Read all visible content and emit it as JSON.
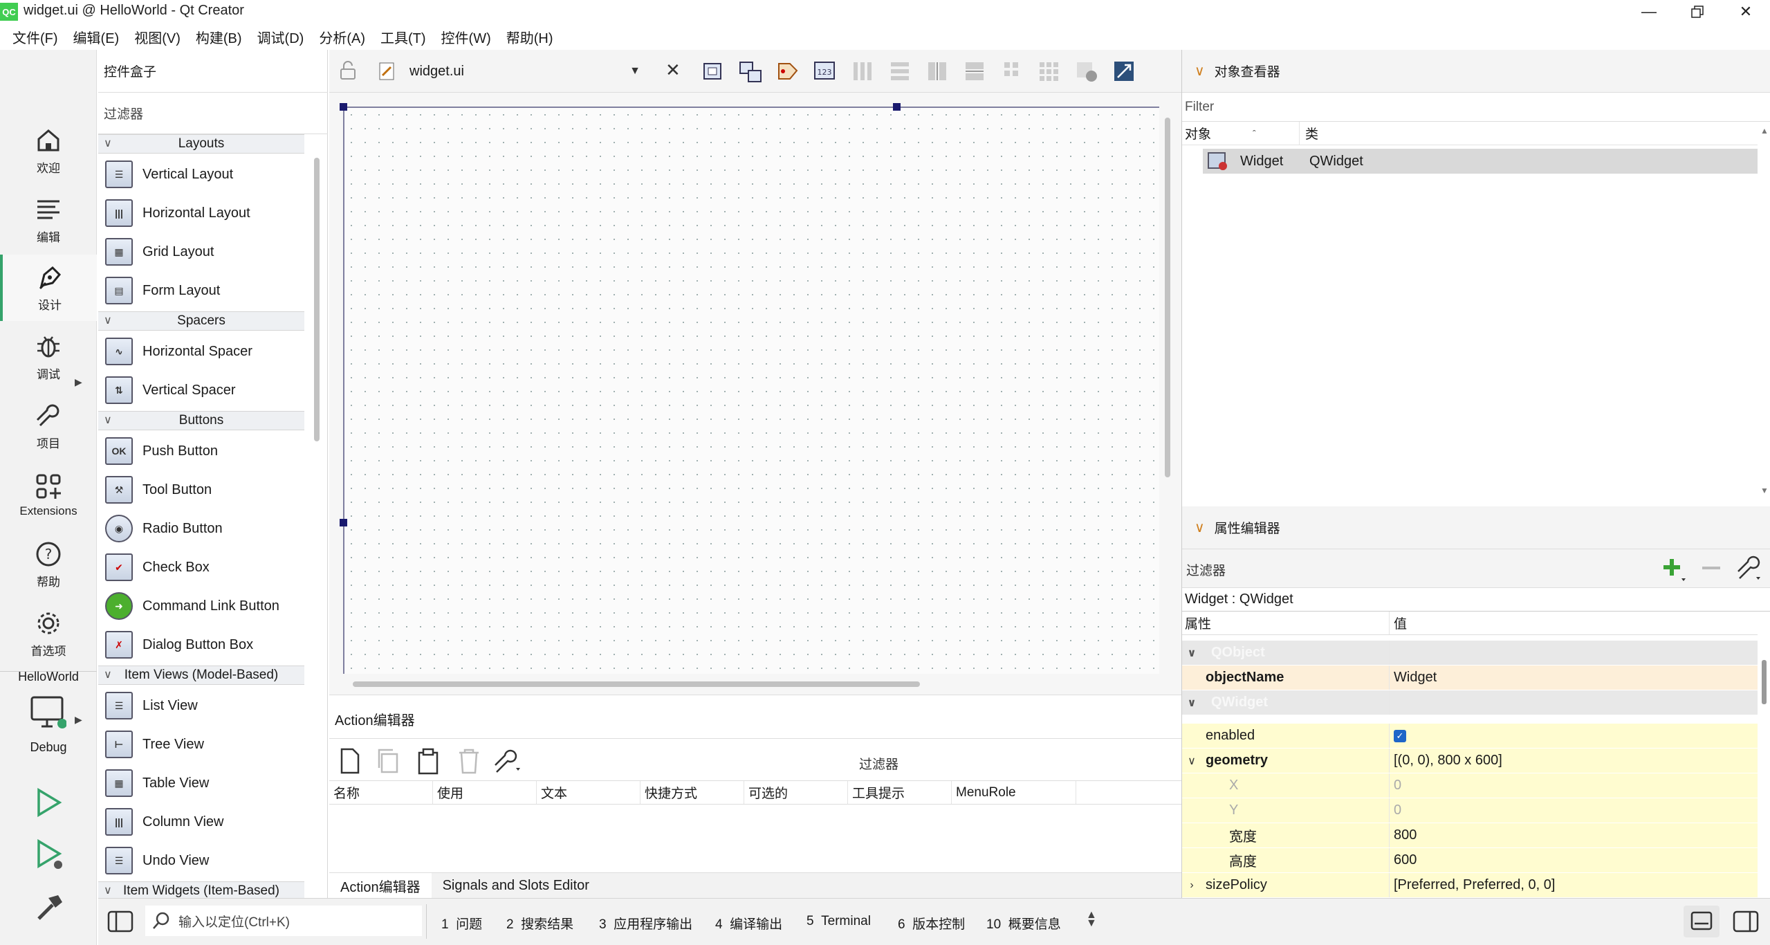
{
  "window": {
    "title": "widget.ui @ HelloWorld - Qt Creator",
    "app_icon": "QC"
  },
  "menubar": [
    "文件(F)",
    "编辑(E)",
    "视图(V)",
    "构建(B)",
    "调试(D)",
    "分析(A)",
    "工具(T)",
    "控件(W)",
    "帮助(H)"
  ],
  "modes": [
    {
      "label": "欢迎",
      "icon": "home-icon"
    },
    {
      "label": "编辑",
      "icon": "edit-lines-icon"
    },
    {
      "label": "设计",
      "icon": "pen-nib-icon"
    },
    {
      "label": "调试",
      "icon": "bug-icon"
    },
    {
      "label": "项目",
      "icon": "wrench-icon"
    },
    {
      "label": "Extensions",
      "icon": "extensions-icon"
    },
    {
      "label": "帮助",
      "icon": "help-icon"
    },
    {
      "label": "首选项",
      "icon": "gear-icon"
    }
  ],
  "kit": {
    "project": "HelloWorld",
    "config": "Debug"
  },
  "widgetbox": {
    "title": "控件盒子",
    "filter_placeholder": "过滤器",
    "categories": {
      "layouts": "Layouts",
      "spacers": "Spacers",
      "buttons": "Buttons",
      "item_views": "Item Views (Model-Based)",
      "item_widgets": "Item Widgets (Item-Based)"
    },
    "items": {
      "vertical_layout": "Vertical Layout",
      "horizontal_layout": "Horizontal Layout",
      "grid_layout": "Grid Layout",
      "form_layout": "Form Layout",
      "horizontal_spacer": "Horizontal Spacer",
      "vertical_spacer": "Vertical Spacer",
      "push_button": "Push Button",
      "tool_button": "Tool Button",
      "radio_button": "Radio Button",
      "check_box": "Check Box",
      "command_link_button": "Command Link Button",
      "dialog_button_box": "Dialog Button Box",
      "list_view": "List View",
      "tree_view": "Tree View",
      "table_view": "Table View",
      "column_view": "Column View",
      "undo_view": "Undo View"
    },
    "push_button_icon_text": "OK"
  },
  "editor": {
    "file": "widget.ui"
  },
  "action_editor": {
    "title": "Action编辑器",
    "filter": "过滤器",
    "columns": [
      "名称",
      "使用",
      "文本",
      "快捷方式",
      "可选的",
      "工具提示",
      "MenuRole"
    ],
    "tabs": [
      "Action编辑器",
      "Signals and Slots Editor"
    ]
  },
  "object_inspector": {
    "title": "对象查看器",
    "filter_placeholder": "Filter",
    "columns": [
      "对象",
      "类"
    ],
    "row": {
      "object": "Widget",
      "class": "QWidget"
    }
  },
  "property_editor": {
    "title": "属性编辑器",
    "filter": "过滤器",
    "object_line": "Widget : QWidget",
    "columns": [
      "属性",
      "值"
    ],
    "rows": [
      {
        "name": "QObject",
        "value": ""
      },
      {
        "name": "objectName",
        "value": "Widget"
      },
      {
        "name": "QWidget",
        "value": ""
      },
      {
        "name": "enabled",
        "value": ""
      },
      {
        "name": "geometry",
        "value": "[(0, 0), 800 x 600]"
      },
      {
        "name": "X",
        "value": "0"
      },
      {
        "name": "Y",
        "value": "0"
      },
      {
        "name": "宽度",
        "value": "800"
      },
      {
        "name": "高度",
        "value": "600"
      },
      {
        "name": "sizePolicy",
        "value": "[Preferred, Preferred, 0, 0]"
      }
    ],
    "enabled_checked": true
  },
  "statusbar": {
    "locator_placeholder": "输入以定位(Ctrl+K)",
    "panes": [
      {
        "num": "1",
        "label": "问题"
      },
      {
        "num": "2",
        "label": "搜索结果"
      },
      {
        "num": "3",
        "label": "应用程序输出"
      },
      {
        "num": "4",
        "label": "编译输出"
      },
      {
        "num": "5",
        "label": "Terminal"
      },
      {
        "num": "6",
        "label": "版本控制"
      },
      {
        "num": "10",
        "label": "概要信息"
      }
    ]
  },
  "colors": {
    "accent": "#35a36b",
    "handle": "#1a1a6e",
    "property_yellow": "#fffcd0",
    "property_changed": "#fdefd9",
    "qt_green": "#41cd52"
  }
}
